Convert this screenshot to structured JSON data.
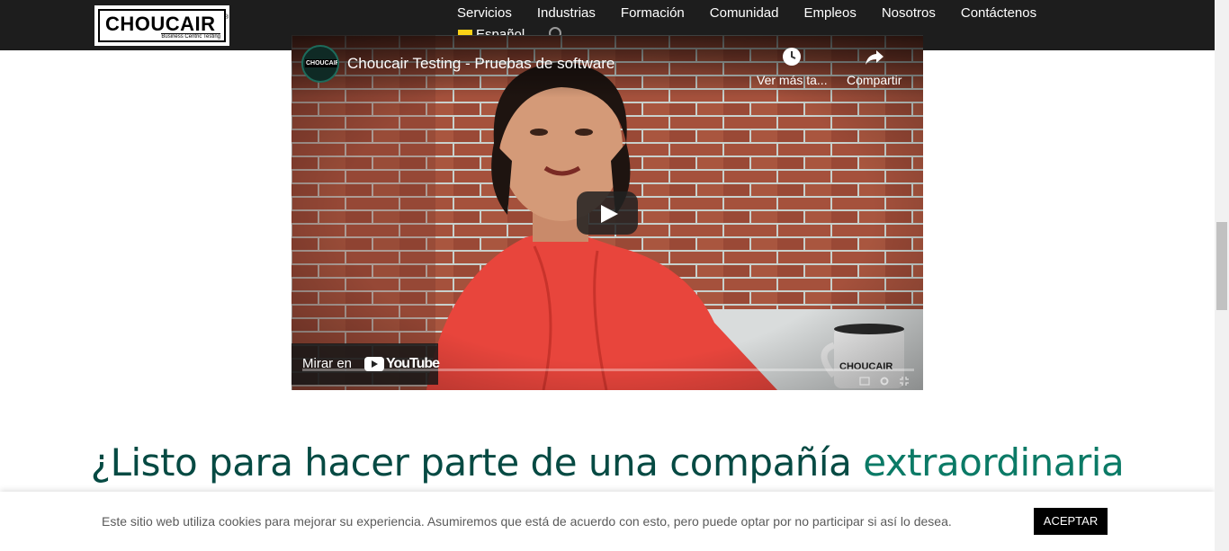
{
  "header": {
    "logo_text": "CHOUCAIR",
    "logo_tagline": "Business Centric Testing",
    "nav": [
      "Servicios",
      "Industrias",
      "Formación",
      "Comunidad",
      "Empleos",
      "Nosotros",
      "Contáctenos"
    ],
    "language": "Español"
  },
  "video": {
    "channel_avatar_text": "CHOUCAIR",
    "title": "Choucair Testing - Pruebas de software",
    "watch_later_label": "Ver más ta...",
    "share_label": "Compartir",
    "watch_on_label": "Mirar en",
    "youtube_label": "YouTube"
  },
  "headline": {
    "main": "¿Listo para hacer parte de una compañía ",
    "accent": "extraordinaria"
  },
  "cookie_banner": {
    "text": "Este sitio web utiliza cookies para mejorar su experiencia. Asumiremos que está de acuerdo con esto, pero puede optar por no participar si así lo desea.",
    "accept_label": "ACEPTAR"
  },
  "colors": {
    "header_bg": "#1d1d1d",
    "headline": "#064a43",
    "accent": "#0b7a66"
  }
}
